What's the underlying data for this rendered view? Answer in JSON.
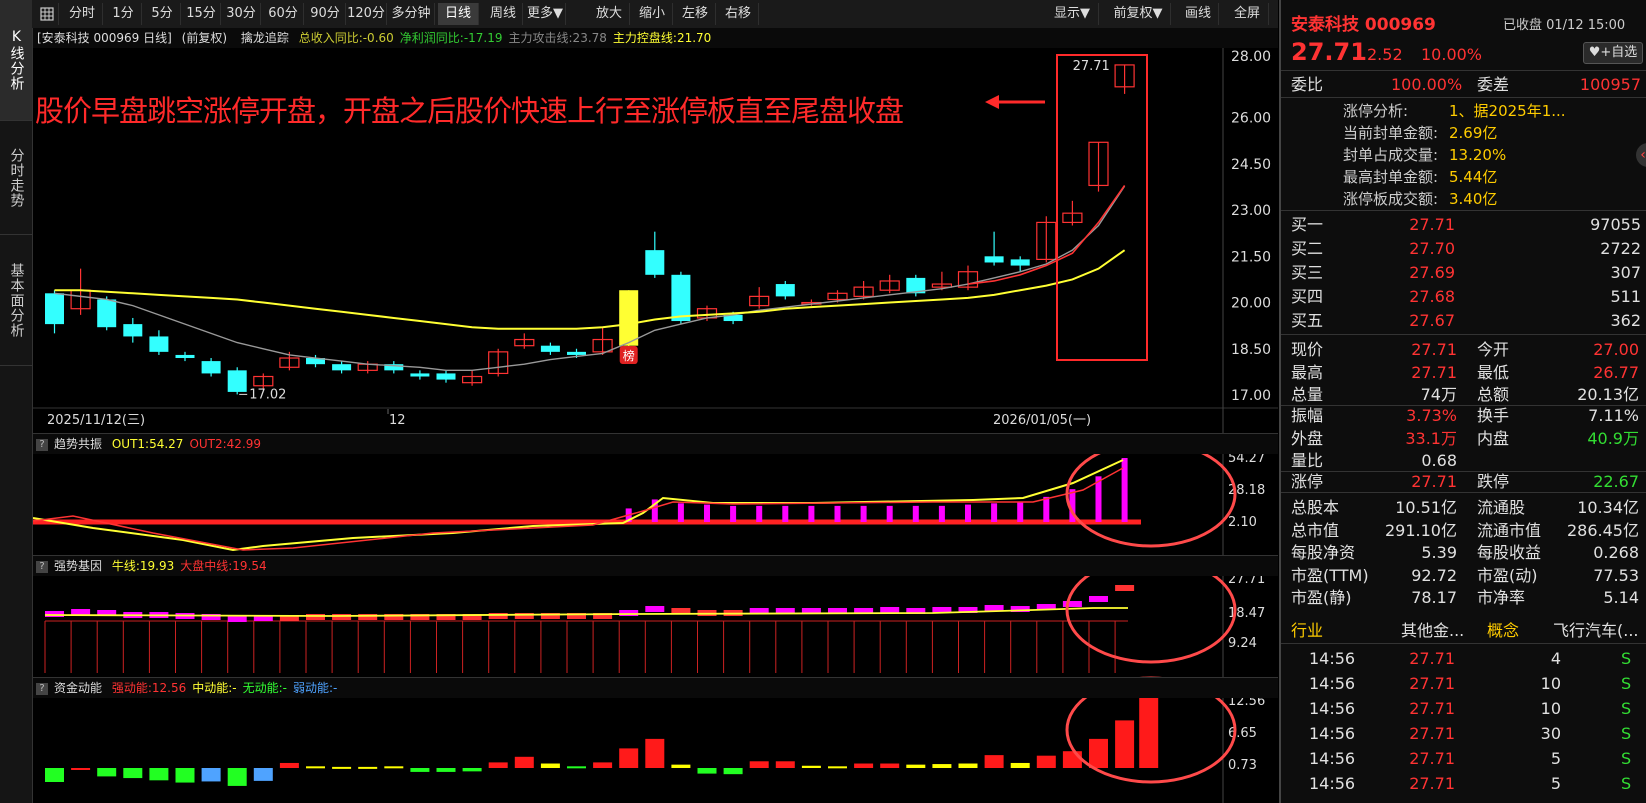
{
  "left_tabs": [
    {
      "label": "K线分析",
      "active": true
    },
    {
      "label": "分时走势",
      "active": false
    },
    {
      "label": "基本面分析",
      "active": false
    }
  ],
  "toolbar": {
    "periods": [
      "分时",
      "1分",
      "5分",
      "15分",
      "30分",
      "60分",
      "90分",
      "120分",
      "多分钟",
      "日线",
      "周线",
      "更多▼"
    ],
    "selected_period": "日线",
    "actions": [
      "放大",
      "缩小",
      "左移",
      "右移"
    ],
    "right_actions": [
      "显示▼",
      "前复权▼",
      "画线",
      "全屏"
    ]
  },
  "main_header": {
    "title": "[安泰科技 000969 日线]",
    "adjust": "(前复权)",
    "indicator": "擒龙追踪",
    "fields": [
      {
        "label": "总收入同比:-0.60",
        "color": "#cccc33"
      },
      {
        "label": "净利润同比:-17.19",
        "color": "#33cc33"
      },
      {
        "label": "主力攻击线:23.78",
        "color": "#888888"
      },
      {
        "label": "主力控盘线:21.70",
        "color": "#ffff33"
      }
    ]
  },
  "annotation": "股价早盘跳空涨停开盘，开盘之后股价快速上行至涨停板直至尾盘收盘",
  "main_y_labels": [
    "28.00",
    "26.00",
    "24.50",
    "23.00",
    "21.50",
    "20.00",
    "18.50",
    "17.00"
  ],
  "main_y_values": [
    28.0,
    26.0,
    24.5,
    23.0,
    21.5,
    20.0,
    18.5,
    17.0
  ],
  "x_labels": [
    "2025/11/12(三)",
    "12",
    "2026/01/05(一)"
  ],
  "low_marker": "17.02",
  "high_marker": "27.71",
  "rank_badge": "榜",
  "colors": {
    "up": "#ff3333",
    "down": "#33ffff",
    "ma_gray": "#999999",
    "ma_yellow": "#ffff33",
    "panel_red": "#ff2222",
    "magenta": "#ff00ff"
  },
  "chart_data": [
    {
      "type": "candlestick",
      "title": "安泰科技 000969 日线",
      "ylim": [
        17.0,
        28.0
      ],
      "candles": [
        {
          "o": 20.3,
          "c": 19.3,
          "h": 20.4,
          "l": 19.0
        },
        {
          "o": 19.8,
          "c": 20.4,
          "h": 21.1,
          "l": 19.6
        },
        {
          "o": 20.1,
          "c": 19.2,
          "h": 20.2,
          "l": 19.1
        },
        {
          "o": 19.3,
          "c": 18.9,
          "h": 19.5,
          "l": 18.7
        },
        {
          "o": 18.9,
          "c": 18.4,
          "h": 19.1,
          "l": 18.3
        },
        {
          "o": 18.3,
          "c": 18.2,
          "h": 18.4,
          "l": 18.1
        },
        {
          "o": 18.1,
          "c": 17.7,
          "h": 18.2,
          "l": 17.6
        },
        {
          "o": 17.8,
          "c": 17.1,
          "h": 17.9,
          "l": 17.02
        },
        {
          "o": 17.3,
          "c": 17.6,
          "h": 17.7,
          "l": 17.2
        },
        {
          "o": 17.9,
          "c": 18.2,
          "h": 18.4,
          "l": 17.8
        },
        {
          "o": 18.2,
          "c": 18.0,
          "h": 18.3,
          "l": 17.9
        },
        {
          "o": 18.0,
          "c": 17.8,
          "h": 18.1,
          "l": 17.7
        },
        {
          "o": 17.8,
          "c": 18.0,
          "h": 18.1,
          "l": 17.7
        },
        {
          "o": 18.0,
          "c": 17.8,
          "h": 18.1,
          "l": 17.7
        },
        {
          "o": 17.7,
          "c": 17.6,
          "h": 17.8,
          "l": 17.5
        },
        {
          "o": 17.7,
          "c": 17.5,
          "h": 17.8,
          "l": 17.4
        },
        {
          "o": 17.4,
          "c": 17.6,
          "h": 17.8,
          "l": 17.3
        },
        {
          "o": 17.7,
          "c": 18.4,
          "h": 18.5,
          "l": 17.6
        },
        {
          "o": 18.6,
          "c": 18.8,
          "h": 19.0,
          "l": 18.5
        },
        {
          "o": 18.6,
          "c": 18.4,
          "h": 18.7,
          "l": 18.3
        },
        {
          "o": 18.4,
          "c": 18.3,
          "h": 18.5,
          "l": 18.2
        },
        {
          "o": 18.4,
          "c": 18.8,
          "h": 19.2,
          "l": 18.3
        },
        {
          "o": 18.6,
          "c": 20.4,
          "h": 20.4,
          "l": 18.5
        },
        {
          "o": 21.7,
          "c": 20.9,
          "h": 22.3,
          "l": 20.8
        },
        {
          "o": 20.9,
          "c": 19.4,
          "h": 21.0,
          "l": 19.3
        },
        {
          "o": 19.5,
          "c": 19.8,
          "h": 19.9,
          "l": 19.4
        },
        {
          "o": 19.6,
          "c": 19.4,
          "h": 19.7,
          "l": 19.3
        },
        {
          "o": 19.9,
          "c": 20.2,
          "h": 20.5,
          "l": 19.8
        },
        {
          "o": 20.6,
          "c": 20.2,
          "h": 20.7,
          "l": 20.1
        },
        {
          "o": 20.0,
          "c": 20.0,
          "h": 20.1,
          "l": 19.9
        },
        {
          "o": 20.1,
          "c": 20.3,
          "h": 20.4,
          "l": 20.0
        },
        {
          "o": 20.2,
          "c": 20.5,
          "h": 20.7,
          "l": 20.1
        },
        {
          "o": 20.4,
          "c": 20.7,
          "h": 20.9,
          "l": 20.3
        },
        {
          "o": 20.8,
          "c": 20.3,
          "h": 20.9,
          "l": 20.2
        },
        {
          "o": 20.5,
          "c": 20.6,
          "h": 21.0,
          "l": 20.4
        },
        {
          "o": 20.5,
          "c": 21.0,
          "h": 21.2,
          "l": 20.4
        },
        {
          "o": 21.5,
          "c": 21.3,
          "h": 22.3,
          "l": 21.2
        },
        {
          "o": 21.4,
          "c": 21.2,
          "h": 21.5,
          "l": 21.0
        },
        {
          "o": 21.4,
          "c": 22.6,
          "h": 22.8,
          "l": 21.3
        },
        {
          "o": 22.6,
          "c": 22.9,
          "h": 23.3,
          "l": 22.5
        },
        {
          "o": 23.8,
          "c": 25.2,
          "h": 25.2,
          "l": 23.6
        },
        {
          "o": 27.0,
          "c": 27.71,
          "h": 27.71,
          "l": 26.77
        }
      ],
      "ma_gray": [
        20.3,
        20.2,
        20.1,
        19.9,
        19.6,
        19.3,
        19.0,
        18.7,
        18.5,
        18.3,
        18.2,
        18.1,
        18.0,
        17.95,
        17.9,
        17.8,
        17.8,
        17.9,
        18.0,
        18.15,
        18.25,
        18.35,
        18.7,
        19.1,
        19.3,
        19.5,
        19.6,
        19.75,
        19.85,
        19.95,
        20.05,
        20.15,
        20.25,
        20.35,
        20.45,
        20.6,
        20.8,
        21.0,
        21.25,
        21.7,
        22.5,
        23.78
      ],
      "ma_yellow": [
        20.4,
        20.4,
        20.35,
        20.3,
        20.25,
        20.2,
        20.15,
        20.1,
        20.0,
        19.9,
        19.8,
        19.7,
        19.6,
        19.5,
        19.4,
        19.3,
        19.2,
        19.15,
        19.15,
        19.15,
        19.15,
        19.2,
        19.3,
        19.45,
        19.55,
        19.6,
        19.65,
        19.7,
        19.8,
        19.85,
        19.9,
        19.95,
        20.0,
        20.05,
        20.1,
        20.15,
        20.25,
        20.4,
        20.55,
        20.75,
        21.1,
        21.7
      ]
    },
    {
      "type": "bar",
      "title": "趋势共振",
      "ylim": [
        2.1,
        54.27
      ],
      "y_labels": [
        "54.27",
        "28.18",
        "2.10"
      ],
      "series": [
        {
          "name": "OUT1",
          "values": [
            2.1,
            2.1,
            2.1,
            2.1,
            2.1,
            2.1,
            2.1,
            2.1,
            2.1,
            2.1,
            2.1,
            2.1,
            2.1,
            2.1,
            2.1,
            2.1,
            2.1,
            2.1,
            2.1,
            2.1,
            2.1,
            2.1,
            15,
            22,
            19,
            18,
            17,
            17,
            17,
            17,
            17,
            17,
            17,
            17,
            17,
            18,
            19,
            20,
            24,
            30,
            40,
            54.27
          ]
        }
      ],
      "fields": [
        {
          "label": "OUT1:54.27",
          "color": "#ffff33"
        },
        {
          "label": "OUT2:42.99",
          "color": "#ff3333"
        }
      ]
    },
    {
      "type": "bar",
      "title": "强势基因",
      "ylim": [
        9.24,
        27.71
      ],
      "y_labels": [
        "27.71",
        "18.47",
        "9.24"
      ],
      "fields": [
        {
          "label": "牛线:19.93",
          "color": "#ffff33"
        },
        {
          "label": "大盘中线:19.54",
          "color": "#ff3333"
        }
      ]
    },
    {
      "type": "bar",
      "title": "资金动能",
      "ylim": [
        0.73,
        12.56
      ],
      "y_labels": [
        "12.56",
        "6.65",
        "0.73"
      ],
      "fields": [
        {
          "label": "强动能:12.56",
          "color": "#ff3333"
        },
        {
          "label": "中动能:-",
          "color": "#ffff33"
        },
        {
          "label": "无动能:-",
          "color": "#33ff33"
        },
        {
          "label": "弱动能:-",
          "color": "#4fa3ff"
        }
      ],
      "values": [
        -2.5,
        0,
        -1.5,
        -1.8,
        -2.2,
        -2.6,
        -2.4,
        -3.2,
        -2.3,
        0.9,
        0.3,
        0.2,
        0.2,
        0.3,
        -0.7,
        -0.7,
        -0.6,
        1.0,
        2.0,
        0.8,
        0.3,
        1.0,
        3.5,
        5.2,
        0.6,
        -1.0,
        -1.1,
        1.2,
        1.2,
        0.4,
        0.3,
        0.8,
        0.8,
        0.6,
        0.7,
        0.8,
        2.3,
        0.9,
        2.2,
        3.0,
        5.2,
        8.5,
        12.56
      ],
      "colors": [
        "g",
        "r",
        "g",
        "g",
        "g",
        "g",
        "b",
        "g",
        "b",
        "r",
        "y",
        "y",
        "y",
        "y",
        "g",
        "g",
        "g",
        "r",
        "r",
        "y",
        "g",
        "r",
        "r",
        "r",
        "y",
        "g",
        "g",
        "r",
        "r",
        "y",
        "y",
        "r",
        "r",
        "y",
        "y",
        "y",
        "r",
        "y",
        "r",
        "r",
        "r",
        "r",
        "r"
      ]
    }
  ],
  "quote": {
    "name_code": "安泰科技 000969",
    "status": "已收盘 01/12 15:00",
    "price": "27.71",
    "change": "2.52",
    "pct": "10.00%",
    "fav_button": "+自选",
    "weibi_label": "委比",
    "weibi": "100.00%",
    "weicha_label": "委差",
    "weicha": "100957",
    "limit_analysis": [
      {
        "label": "涨停分析:",
        "value": "1、据2025年1..."
      },
      {
        "label": "当前封单金额:",
        "value": "2.69亿"
      },
      {
        "label": "封单占成交量:",
        "value": "13.20%"
      },
      {
        "label": "最高封单金额:",
        "value": "5.44亿"
      },
      {
        "label": "涨停板成交额:",
        "value": "3.40亿"
      }
    ],
    "bids": [
      {
        "label": "买一",
        "price": "27.71",
        "vol": "97055"
      },
      {
        "label": "买二",
        "price": "27.70",
        "vol": "2722"
      },
      {
        "label": "买三",
        "price": "27.69",
        "vol": "307"
      },
      {
        "label": "买四",
        "price": "27.68",
        "vol": "511"
      },
      {
        "label": "买五",
        "price": "27.67",
        "vol": "362"
      }
    ],
    "stats1": [
      [
        {
          "l": "现价",
          "v": "27.71",
          "c": "red"
        },
        {
          "l": "今开",
          "v": "27.00",
          "c": "red"
        }
      ],
      [
        {
          "l": "最高",
          "v": "27.71",
          "c": "red"
        },
        {
          "l": "最低",
          "v": "26.77",
          "c": "red"
        }
      ],
      [
        {
          "l": "总量",
          "v": "74万",
          "c": "white"
        },
        {
          "l": "总额",
          "v": "20.13亿",
          "c": "white"
        }
      ]
    ],
    "stats2": [
      [
        {
          "l": "振幅",
          "v": "3.73%",
          "c": "red"
        },
        {
          "l": "换手",
          "v": "7.11%",
          "c": "white"
        }
      ],
      [
        {
          "l": "外盘",
          "v": "33.1万",
          "c": "red"
        },
        {
          "l": "内盘",
          "v": "40.9万",
          "c": "green"
        }
      ],
      [
        {
          "l": "量比",
          "v": "0.68",
          "c": "white"
        },
        {
          "l": "",
          "v": "",
          "c": "white"
        }
      ]
    ],
    "stats3": [
      [
        {
          "l": "涨停",
          "v": "27.71",
          "c": "red"
        },
        {
          "l": "跌停",
          "v": "22.67",
          "c": "green"
        }
      ]
    ],
    "stats4": [
      [
        {
          "l": "总股本",
          "v": "10.51亿",
          "c": "white"
        },
        {
          "l": "流通股",
          "v": "10.34亿",
          "c": "white"
        }
      ],
      [
        {
          "l": "总市值",
          "v": "291.10亿",
          "c": "white"
        },
        {
          "l": "流通市值",
          "v": "286.45亿",
          "c": "white"
        }
      ],
      [
        {
          "l": "每股净资",
          "v": "5.39",
          "c": "white"
        },
        {
          "l": "每股收益",
          "v": "0.268",
          "c": "white"
        }
      ],
      [
        {
          "l": "市盈(TTM)",
          "v": "92.72",
          "c": "white"
        },
        {
          "l": "市盈(动)",
          "v": "77.53",
          "c": "white"
        }
      ],
      [
        {
          "l": "市盈(静)",
          "v": "78.17",
          "c": "white"
        },
        {
          "l": "市净率",
          "v": "5.14",
          "c": "white"
        }
      ]
    ],
    "industry_label": "行业",
    "industry": "其他金...",
    "concept_label": "概念",
    "concept": "飞行汽车(...",
    "ticks": [
      {
        "t": "14:56",
        "p": "27.71",
        "v": "4",
        "d": "S"
      },
      {
        "t": "14:56",
        "p": "27.71",
        "v": "10",
        "d": "S"
      },
      {
        "t": "14:56",
        "p": "27.71",
        "v": "10",
        "d": "S"
      },
      {
        "t": "14:56",
        "p": "27.71",
        "v": "30",
        "d": "S"
      },
      {
        "t": "14:56",
        "p": "27.71",
        "v": "5",
        "d": "S"
      },
      {
        "t": "14:56",
        "p": "27.71",
        "v": "5",
        "d": "S"
      }
    ]
  }
}
